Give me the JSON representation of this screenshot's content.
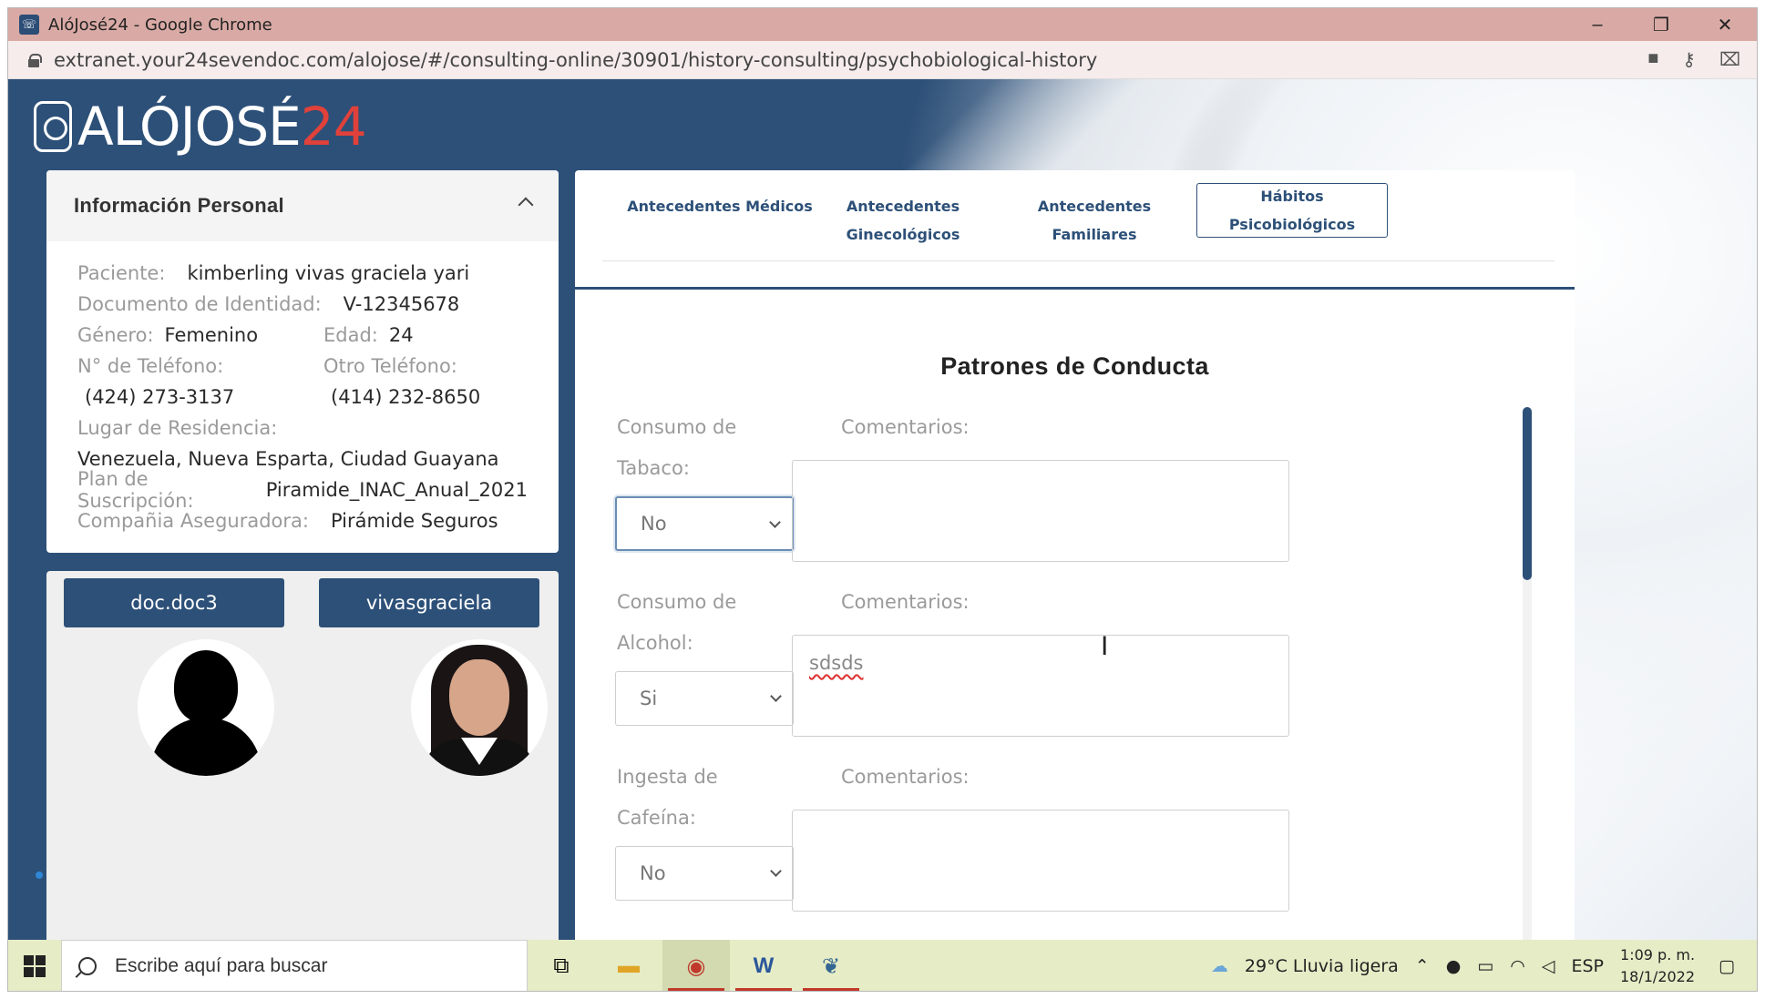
{
  "window": {
    "title": "AlóJosé24 - Google Chrome",
    "controls": [
      "–",
      "❐",
      "✕"
    ]
  },
  "address_bar": {
    "url": "extranet.your24sevendoc.com/alojose/#/consulting-online/30901/history-consulting/psychobiological-history",
    "icons": [
      "camera-icon",
      "key-icon",
      "translate-icon"
    ]
  },
  "logo": {
    "text": "ALÓJOSÉ",
    "number": "24"
  },
  "personal_info": {
    "title": "Información Personal",
    "patient_label": "Paciente:",
    "patient_value": "kimberling vivas graciela yari",
    "document_label": "Documento de Identidad:",
    "document_value": "V-12345678",
    "gender_label": "Género:",
    "gender_value": "Femenino",
    "age_label": "Edad:",
    "age_value": "24",
    "phone_label": "N° de Teléfono:",
    "phone_value": "(424) 273-3137",
    "other_phone_label": "Otro Teléfono:",
    "other_phone_value": "(414) 232-8650",
    "residence_label": "Lugar de Residencia:",
    "residence_value": "Venezuela, Nueva Esparta, Ciudad Guayana",
    "plan_label": "Plan de Suscripción:",
    "plan_value": "Piramide_INAC_Anual_2021",
    "insurer_label": "Compañia Aseguradora:",
    "insurer_value": "Pirámide Seguros"
  },
  "users": {
    "doctor_button": "doc.doc3",
    "patient_button": "vivasgraciela"
  },
  "tabs": {
    "medical": "Antecedentes Médicos",
    "gyneco_line1": "Antecedentes",
    "gyneco_line2": "Ginecológicos",
    "family": "Antecedentes Familiares",
    "psycho": "Hábitos Psicobiológicos"
  },
  "section": {
    "title": "Patrones de Conducta",
    "tobacco_label_1": "Consumo de",
    "tobacco_label_2": "Tabaco:",
    "tobacco_value": "No",
    "alcohol_label_1": "Consumo de",
    "alcohol_label_2": "Alcohol:",
    "alcohol_value": "Si",
    "caffeine_label_1": "Ingesta de",
    "caffeine_label_2": "Cafeína:",
    "caffeine_value": "No",
    "comments_label": "Comentarios:",
    "tobacco_comment": "",
    "alcohol_comment": "sdsds",
    "caffeine_comment": ""
  },
  "taskbar": {
    "search_placeholder": "Escribe aquí para buscar",
    "weather": "29°C  Lluvia ligera",
    "language": "ESP",
    "time": "1:09 p. m.",
    "date": "18/1/2022"
  }
}
